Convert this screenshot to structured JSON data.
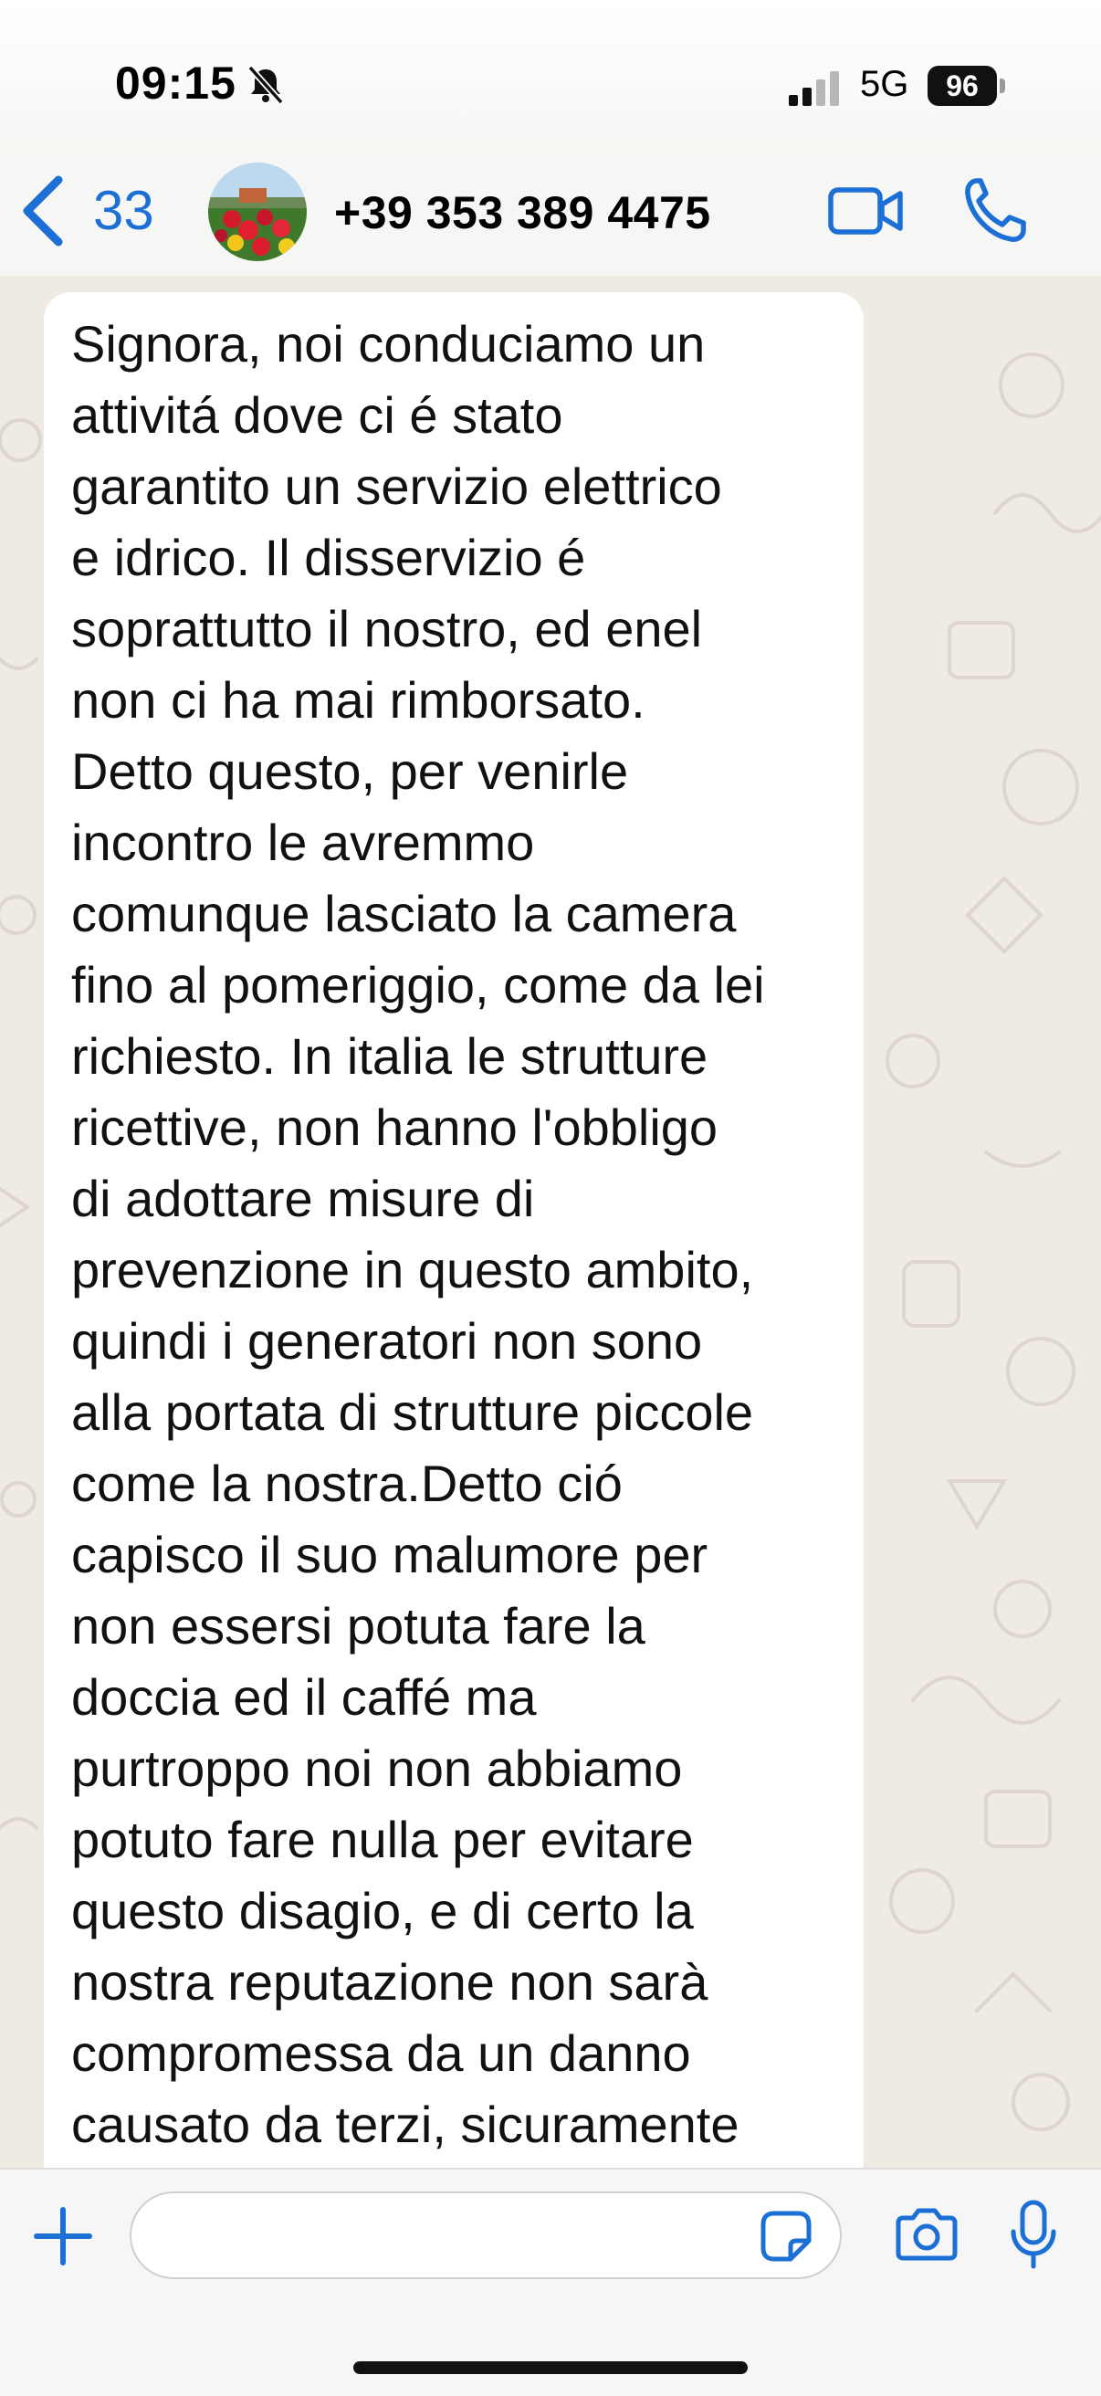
{
  "status_bar": {
    "time": "09:15",
    "network": "5G",
    "battery": "96",
    "icons": [
      "bell-slash-icon",
      "cellular-signal-icon",
      "battery-icon"
    ]
  },
  "header": {
    "back_count": "33",
    "contact_name": "+39 353 389 4475",
    "icons": [
      "chevron-left-icon",
      "video-camera-icon",
      "phone-icon"
    ]
  },
  "chat": {
    "messages": [
      {
        "direction": "incoming",
        "lines": [
          "Signora, noi conduciamo un",
          "attivitá dove ci é stato",
          "garantito un servizio elettrico",
          "e idrico. Il disservizio é",
          "soprattutto il nostro, ed enel",
          "non ci ha mai rimborsato.",
          "Detto questo, per venirle",
          "incontro le avremmo",
          "comunque lasciato la camera",
          "fino al pomeriggio, come da lei",
          "richiesto. In italia le strutture",
          "ricettive, non hanno l'obbligo",
          "di adottare misure di",
          "prevenzione in questo ambito,",
          "quindi i generatori non sono",
          "alla portata di strutture piccole",
          "come la nostra.Detto ció",
          "capisco il suo malumore per",
          "non essersi potuta fare la",
          "doccia ed il caffé ma",
          "purtroppo noi non abbiamo",
          "potuto fare nulla per evitare",
          "questo disagio, e di certo la",
          "nostra reputazione non sarà",
          "compromessa da un danno",
          "causato da terzi, sicuramente"
        ]
      }
    ]
  },
  "composer": {
    "input_value": "",
    "icons": [
      "plus-icon",
      "sticker-icon",
      "camera-icon",
      "microphone-icon"
    ]
  },
  "colors": {
    "accent": "#1c6fd4",
    "chat_background": "#efeae2",
    "bubble_background": "#ffffff"
  }
}
